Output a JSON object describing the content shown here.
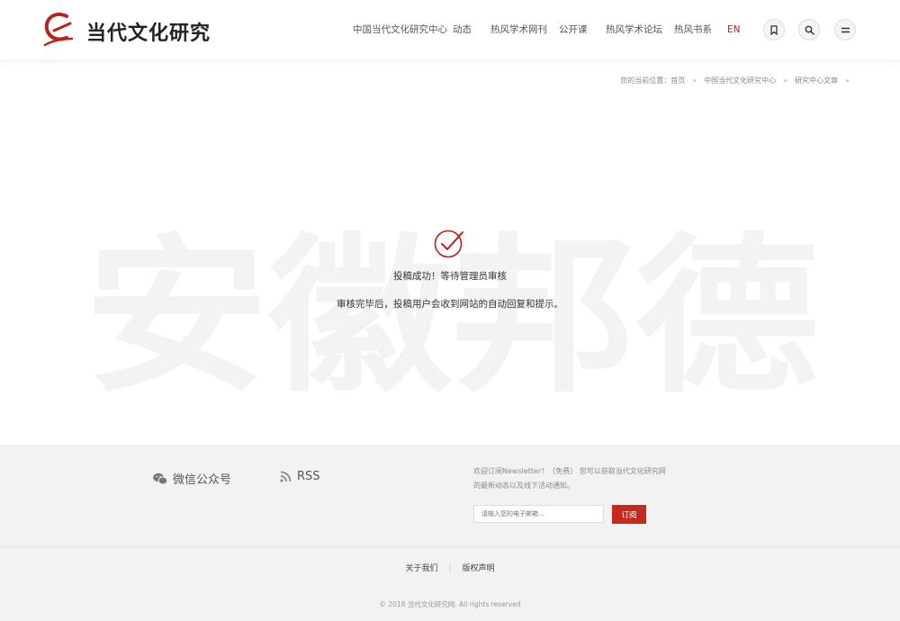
{
  "header": {
    "brand": "当代文化研究",
    "nav": [
      {
        "label": "中国当代文化研究中心"
      },
      {
        "label": "动态"
      },
      {
        "label": "热风学术网刊"
      },
      {
        "label": "公开课"
      },
      {
        "label": "热风学术论坛"
      },
      {
        "label": "热风书系"
      },
      {
        "label": "EN"
      }
    ],
    "icons": [
      "bookmark-icon",
      "search-icon",
      "menu-icon"
    ],
    "accent": "#b8231c"
  },
  "breadcrumb": {
    "prefix": "您的当前位置：",
    "items": [
      "首页",
      "中国当代文化研究中心",
      "研究中心文章"
    ],
    "separator": "»"
  },
  "main": {
    "watermark": "安徽邦德",
    "success_title": "投稿成功！等待管理员审核",
    "success_detail": "审核完毕后，投稿用户会收到网站的自动回复和提示。",
    "check_color": "#b8231c"
  },
  "footer": {
    "wechat_label": "微信公众号",
    "rss_label": "RSS",
    "newsletter_text": "欢迎订阅Newsletter！（免费） 您可以获取当代文化研究网的最新动态以及线下活动通知。",
    "email_placeholder": "请输入您的电子邮箱...",
    "subscribe_label": "订阅",
    "links": [
      "关于我们",
      "版权声明"
    ],
    "copyright": "© 2018 当代文化研究网. All rights reserved",
    "button_color": "#c7281d"
  }
}
